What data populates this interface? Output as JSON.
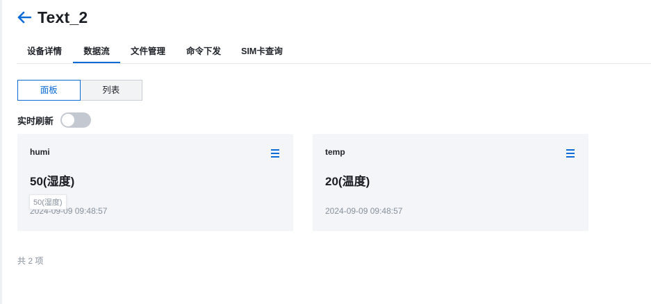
{
  "header": {
    "title": "Text_2"
  },
  "tabs": [
    {
      "label": "设备详情"
    },
    {
      "label": "数据流"
    },
    {
      "label": "文件管理"
    },
    {
      "label": "命令下发"
    },
    {
      "label": "SIM卡查询"
    }
  ],
  "active_tab": 1,
  "view_toggle": {
    "panel_label": "面板",
    "list_label": "列表",
    "active": "panel"
  },
  "refresh": {
    "label": "实时刷新",
    "enabled": false
  },
  "cards": [
    {
      "name": "humi",
      "value": "50(湿度)",
      "time": "2024-09-09 09:48:57",
      "tooltip": "50(湿度)"
    },
    {
      "name": "temp",
      "value": "20(温度)",
      "time": "2024-09-09 09:48:57"
    }
  ],
  "footer": {
    "total": "共 2 项"
  },
  "colors": {
    "accent": "#0a6bd6",
    "card_bg": "#f3f5f8",
    "muted_text": "#86909c"
  },
  "icons": {
    "back": "arrow-left-icon",
    "menu": "menu-icon"
  }
}
